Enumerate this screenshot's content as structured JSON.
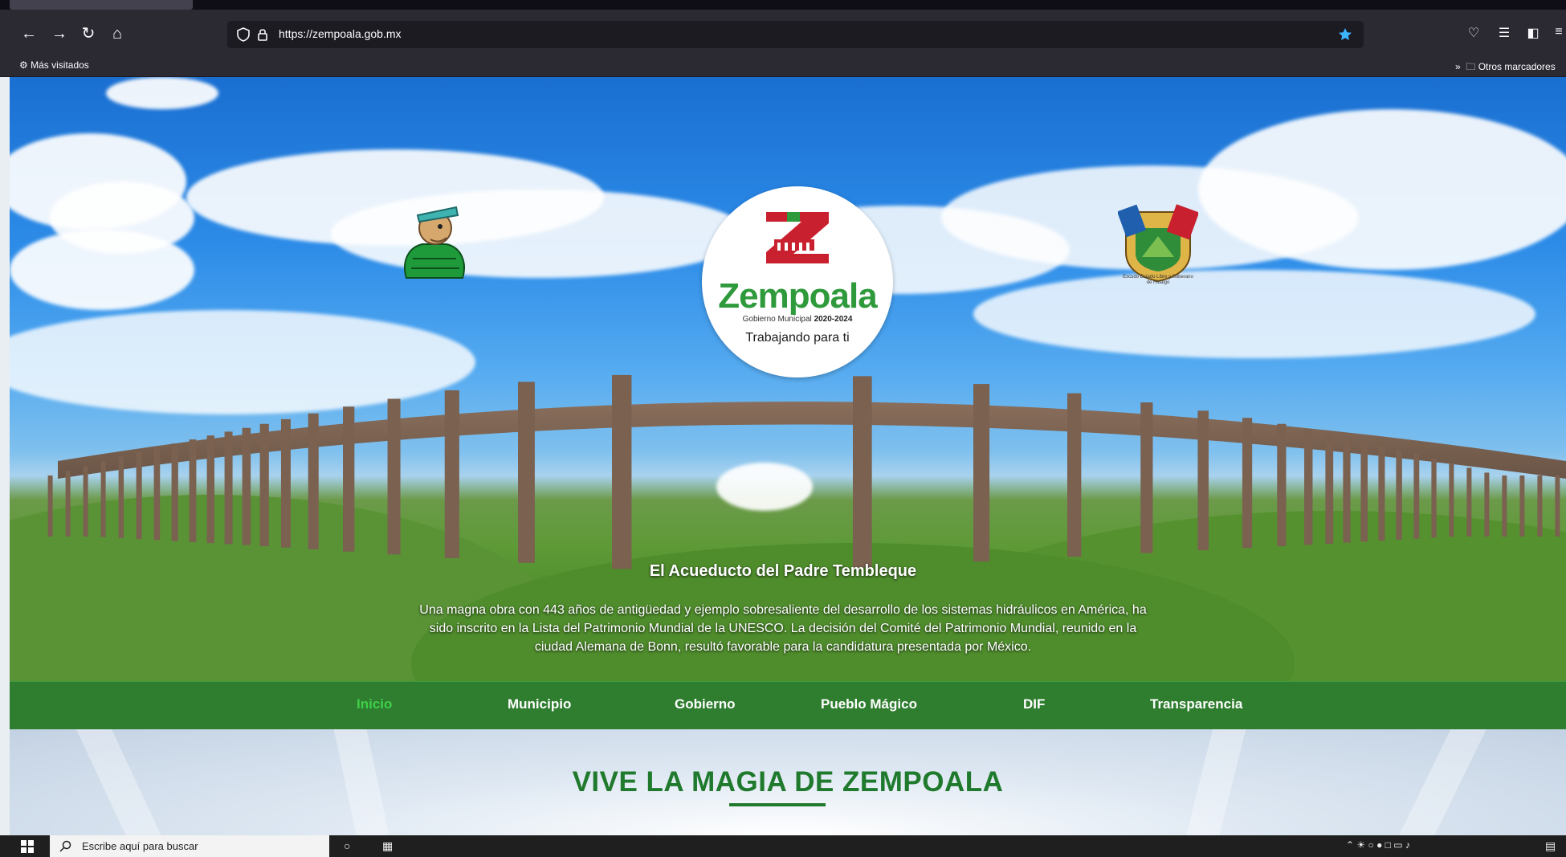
{
  "browser": {
    "url": "https://zempoala.gob.mx",
    "bookmarks": {
      "left_label": "Más visitados",
      "right_label": "Otros marcadores"
    },
    "icons": [
      "back-icon",
      "forward-icon",
      "reload-icon",
      "home-icon",
      "shield-icon",
      "lock-icon",
      "star-icon",
      "pocket-icon",
      "library-icon",
      "sidebar-icon",
      "menu-icon"
    ]
  },
  "hero": {
    "logo": {
      "name": "Zempoala",
      "subtitle_prefix": "Gobierno Municipal",
      "subtitle_years": "2020-2024",
      "tagline": "Trabajando para ti"
    },
    "caption_title": "El Acueducto del Padre Tembleque",
    "caption_body": "Una magna obra con 443 años de antigüedad y ejemplo sobresaliente del desarrollo de los sistemas hidráulicos en América, ha sido inscrito en la Lista del Patrimonio Mundial de la UNESCO. La decisión del Comité del Patrimonio Mundial, reunido en la ciudad Alemana de Bonn, resultó favorable para la candidatura presentada por México.",
    "shield_caption": "Escudo Estado Libre y Soberano de Hidalgo"
  },
  "nav": {
    "items": [
      {
        "label": "Inicio",
        "active": true
      },
      {
        "label": "Municipio",
        "active": false
      },
      {
        "label": "Gobierno",
        "active": false
      },
      {
        "label": "Pueblo Mágico",
        "active": false
      },
      {
        "label": "DIF",
        "active": false
      },
      {
        "label": "Transparencia",
        "active": false
      }
    ]
  },
  "section": {
    "title": "VIVE LA MAGIA DE ZEMPOALA"
  },
  "taskbar": {
    "search_placeholder": "Escribe aquí para buscar"
  },
  "colors": {
    "nav_bg": "#2f7d2f",
    "nav_active": "#3fd04a",
    "brand_green": "#2f9a3b",
    "brand_red": "#c8202e",
    "section_title": "#1f7a2d"
  }
}
